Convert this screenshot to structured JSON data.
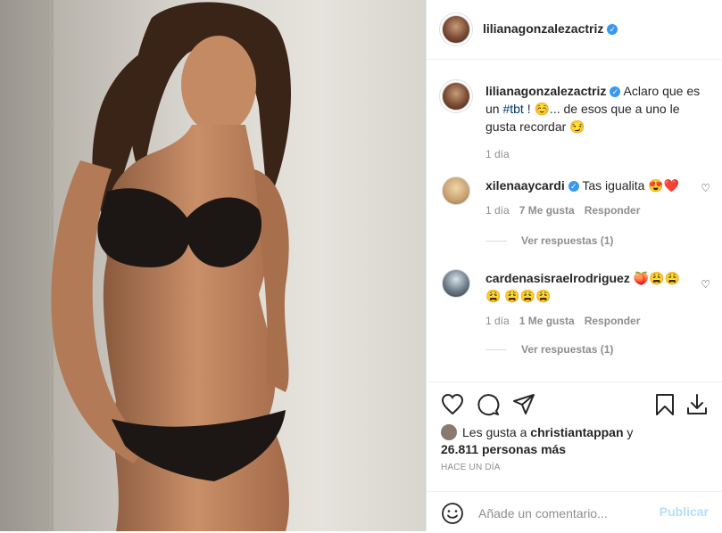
{
  "post": {
    "username": "lilianagonzalezactriz",
    "caption": {
      "hashtag": "#tbt",
      "before_tag": "Aclaro que es un ",
      "after_tag": " ! ☺️... de esos que a uno le gusta recordar 😏",
      "time": "1 día"
    }
  },
  "comments": [
    {
      "username": "xilenaaycardi",
      "verified": true,
      "text": "Tas igualita 😍❤️",
      "time": "1 día",
      "likes": "7 Me gusta",
      "reply": "Responder",
      "view_replies": "Ver respuestas (1)"
    },
    {
      "username": "cardenasisraelrodriguez",
      "verified": false,
      "text": "🍑😩😩😩 😩😩😩",
      "time": "1 día",
      "likes": "1 Me gusta",
      "reply": "Responder",
      "view_replies": "Ver respuestas (1)"
    }
  ],
  "likes": {
    "prefix": "Les gusta a ",
    "user": "christiantappan",
    "suffix": " y",
    "count": "26.811 personas más"
  },
  "timestamp": "HACE UN DÍA",
  "add_comment": {
    "placeholder": "Añade un comentario...",
    "post_label": "Publicar"
  },
  "icons": {
    "like": "heart-icon",
    "comment": "comment-icon",
    "share": "share-icon",
    "save": "bookmark-icon",
    "download": "download-icon",
    "emoji": "smiley-icon"
  },
  "colors": {
    "verified": "#3897f0",
    "publish_disabled": "#b2dffc",
    "hashtag": "#00376b"
  }
}
